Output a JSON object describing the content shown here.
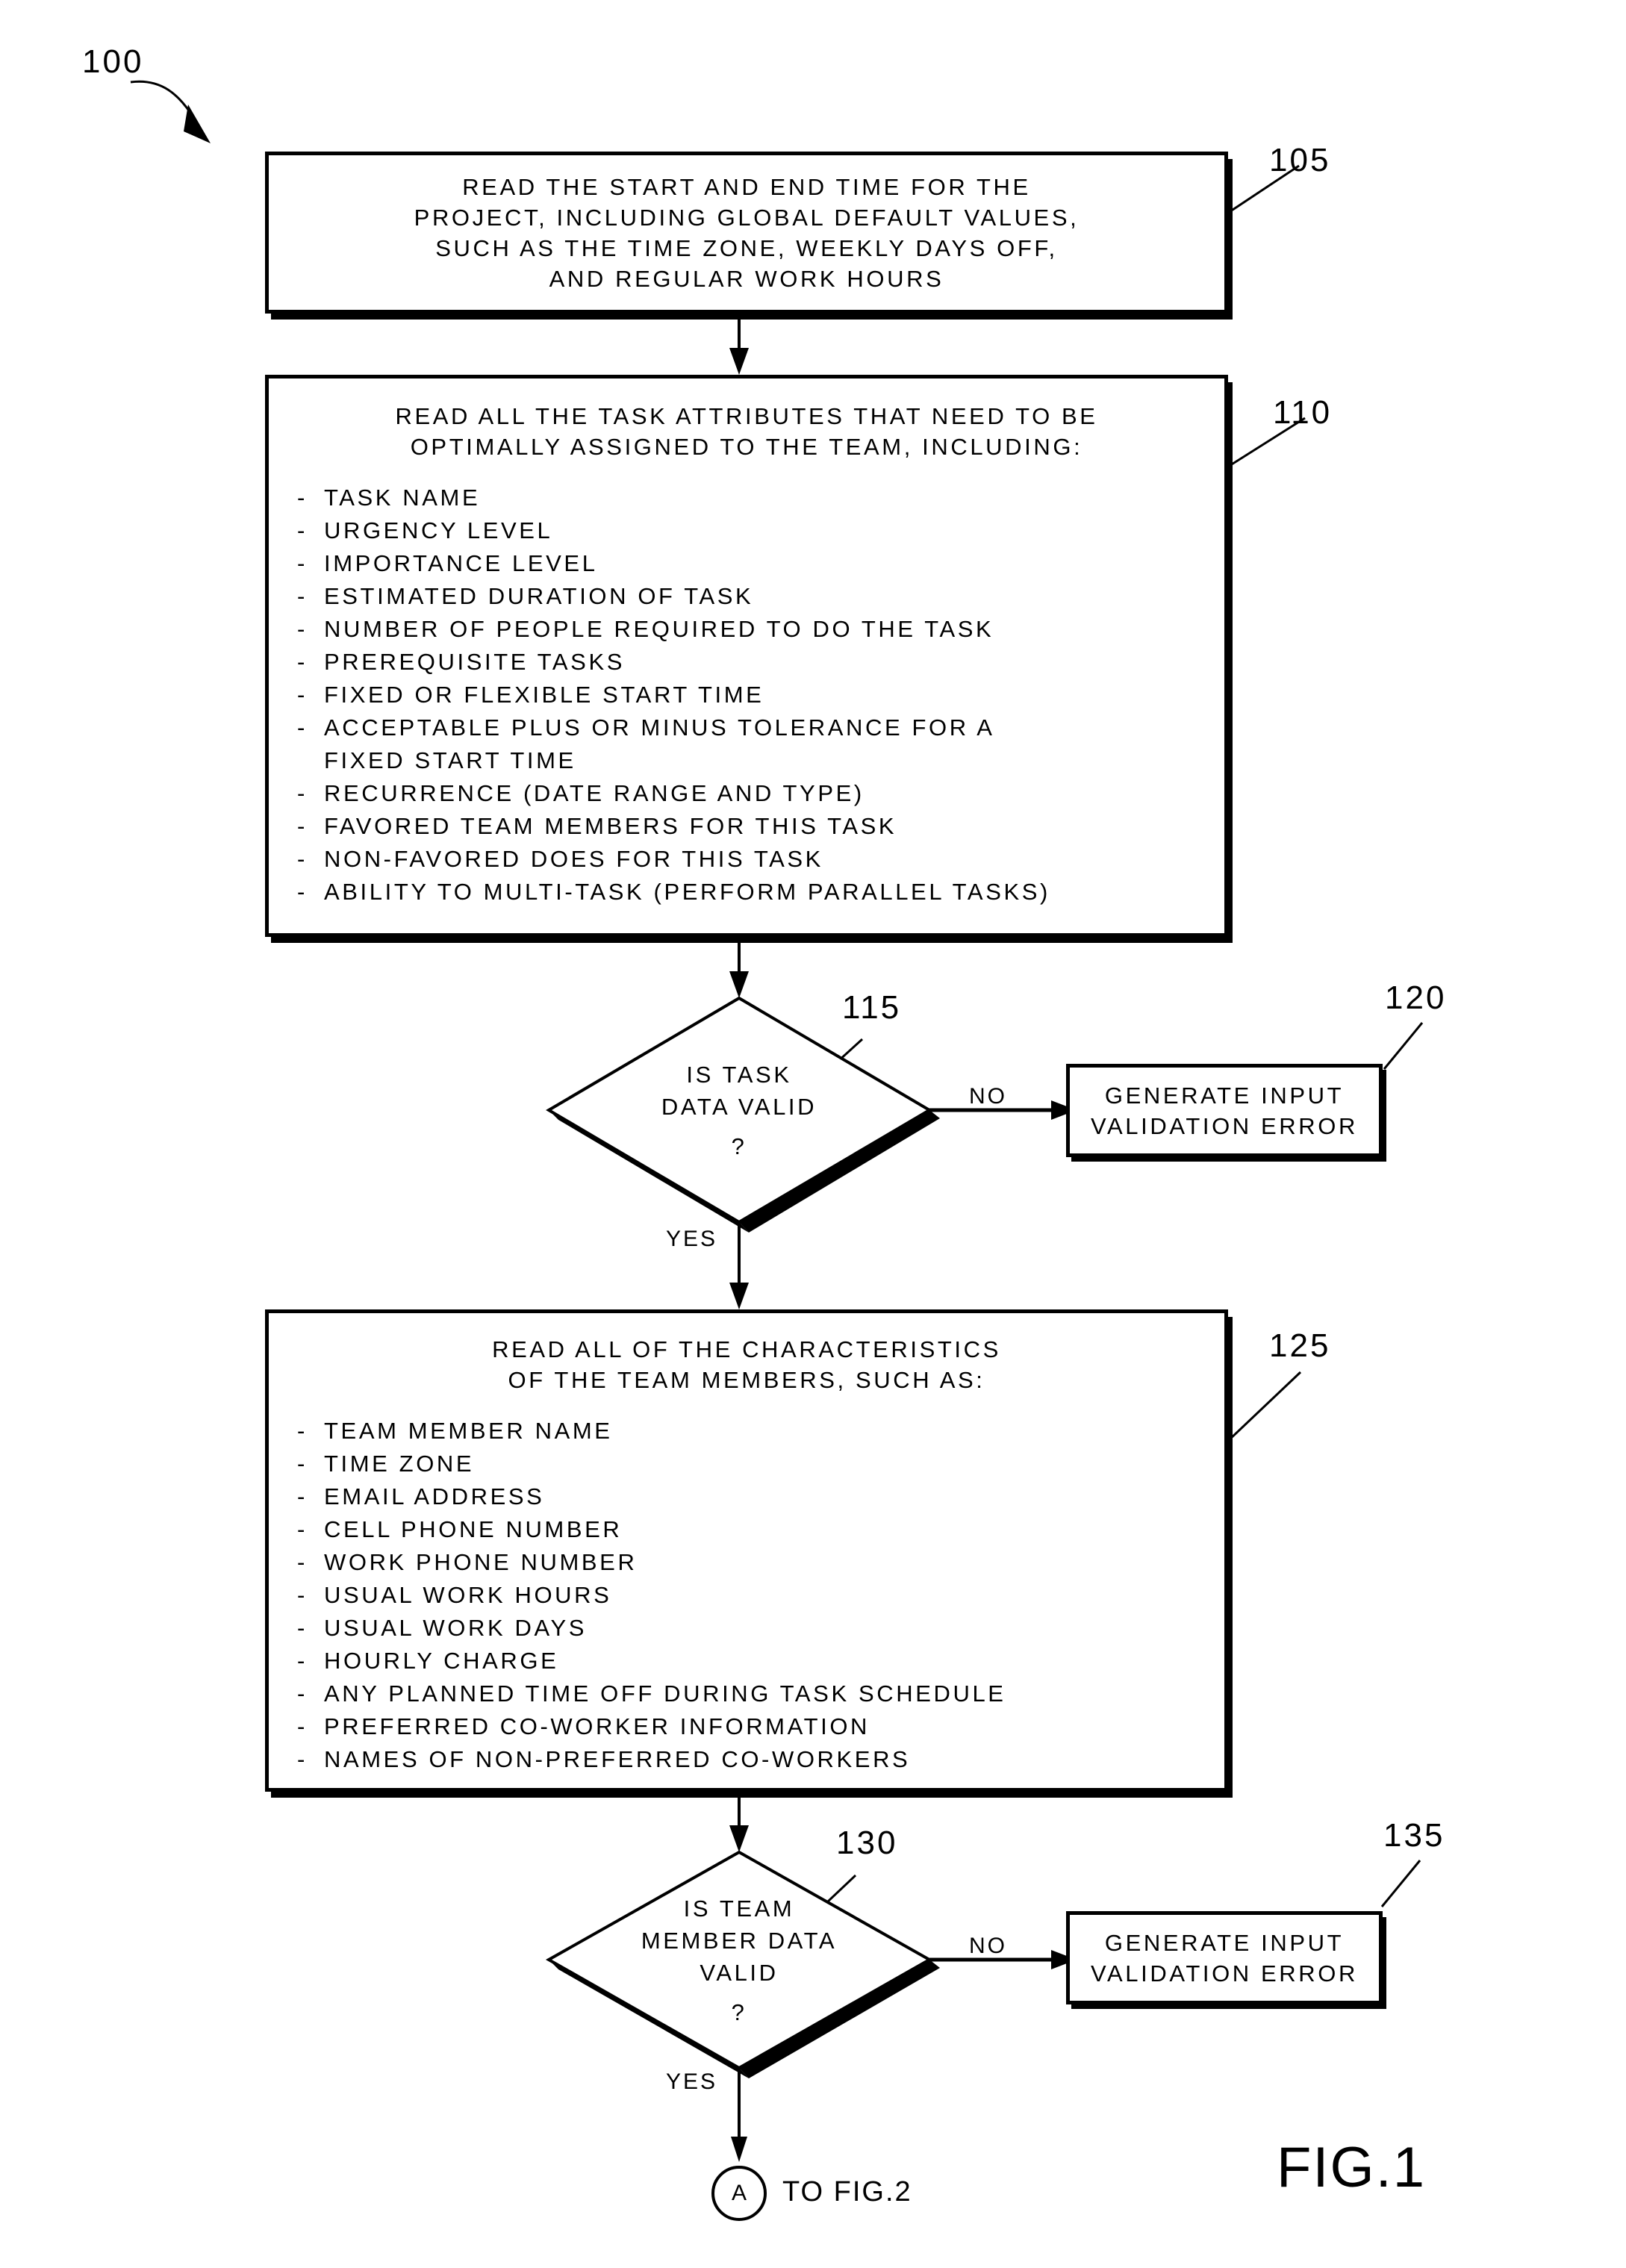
{
  "figure": {
    "number_label": "100",
    "caption": "FIG.1"
  },
  "nodes": {
    "box105": {
      "ref": "105",
      "lines": [
        "READ THE START AND END TIME FOR THE",
        "PROJECT, INCLUDING GLOBAL DEFAULT VALUES,",
        "SUCH AS THE TIME ZONE, WEEKLY DAYS OFF,",
        "AND REGULAR WORK HOURS"
      ]
    },
    "box110": {
      "ref": "110",
      "heading": [
        "READ ALL THE TASK ATTRIBUTES THAT NEED TO BE",
        "OPTIMALLY ASSIGNED TO THE TEAM, INCLUDING:"
      ],
      "items": [
        "TASK NAME",
        "URGENCY LEVEL",
        "IMPORTANCE LEVEL",
        "ESTIMATED DURATION OF TASK",
        "NUMBER OF PEOPLE REQUIRED TO DO THE TASK",
        "PREREQUISITE TASKS",
        "FIXED OR FLEXIBLE START TIME",
        "ACCEPTABLE PLUS OR MINUS TOLERANCE FOR A",
        "RECURRENCE (DATE RANGE AND TYPE)",
        "FAVORED TEAM MEMBERS FOR THIS TASK",
        "NON-FAVORED DOES FOR THIS TASK",
        "ABILITY TO MULTI-TASK (PERFORM PARALLEL TASKS)"
      ],
      "item_8_continuation": "FIXED START TIME"
    },
    "diamond115": {
      "ref": "115",
      "lines": [
        "IS TASK",
        "DATA VALID"
      ],
      "question_mark": "?"
    },
    "box120": {
      "ref": "120",
      "lines": [
        "GENERATE INPUT",
        "VALIDATION ERROR"
      ]
    },
    "box125": {
      "ref": "125",
      "heading": [
        "READ ALL OF THE CHARACTERISTICS",
        "OF THE TEAM MEMBERS, SUCH AS:"
      ],
      "items": [
        "TEAM MEMBER NAME",
        "TIME ZONE",
        "EMAIL ADDRESS",
        "CELL PHONE NUMBER",
        "WORK PHONE NUMBER",
        "USUAL WORK HOURS",
        "USUAL WORK DAYS",
        "HOURLY CHARGE",
        "ANY PLANNED TIME OFF DURING TASK SCHEDULE",
        "PREFERRED CO-WORKER INFORMATION",
        "NAMES OF NON-PREFERRED CO-WORKERS"
      ]
    },
    "diamond130": {
      "ref": "130",
      "lines": [
        "IS TEAM",
        "MEMBER DATA",
        "VALID"
      ],
      "question_mark": "?"
    },
    "box135": {
      "ref": "135",
      "lines": [
        "GENERATE INPUT",
        "VALIDATION ERROR"
      ]
    },
    "connector": {
      "letter": "A",
      "target": "TO FIG.2"
    }
  },
  "edges": {
    "no_115": "NO",
    "yes_115": "YES",
    "no_130": "NO",
    "yes_130": "YES"
  },
  "style": {
    "ink": "#000000",
    "paper": "#ffffff"
  }
}
